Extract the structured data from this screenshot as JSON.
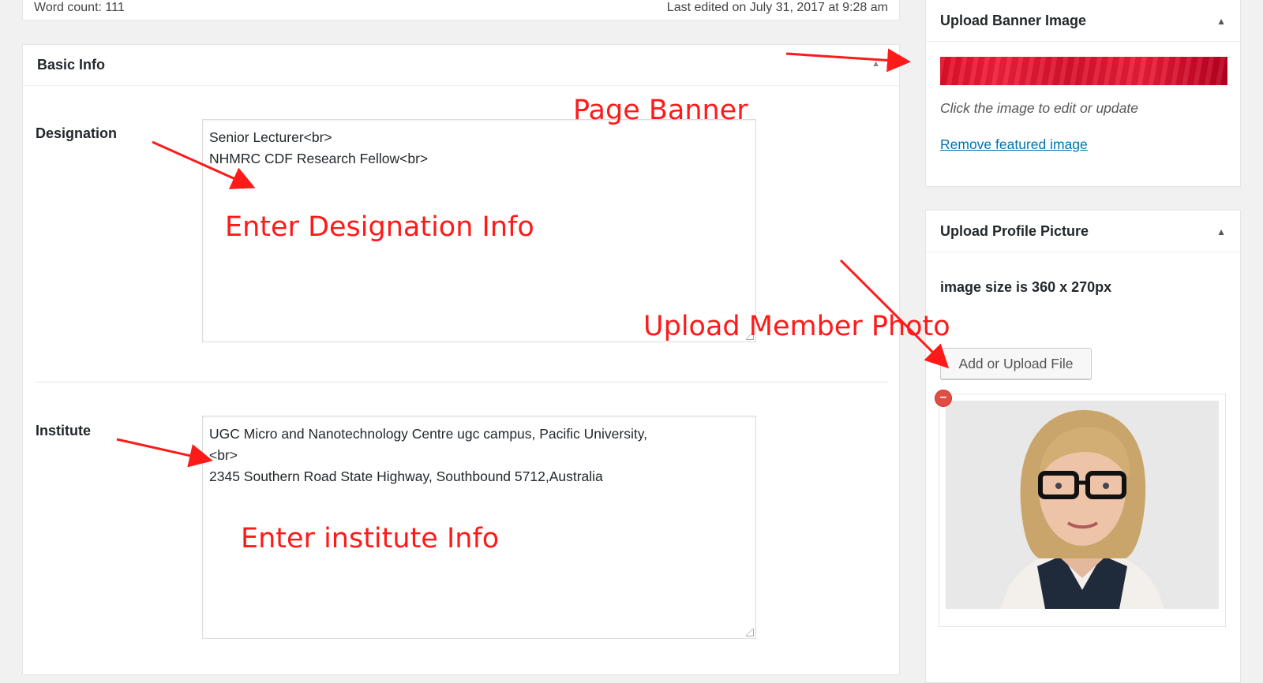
{
  "status_bar": {
    "word_count": "Word count: 111",
    "last_edited": "Last edited on July 31, 2017 at 9:28 am"
  },
  "basic_info": {
    "title": "Basic Info",
    "toggle_icon": "triangle-up-icon",
    "designation": {
      "label": "Designation",
      "lines": [
        "Senior Lecturer<br>",
        "NHMRC CDF Research Fellow<br>"
      ]
    },
    "institute": {
      "label": "Institute",
      "lines": [
        "UGC Micro and Nanotechnology Centre ugc campus, Pacific University,",
        "<br>",
        "2345 Southern Road State Highway, Southbound 5712,Australia"
      ]
    }
  },
  "banner_panel": {
    "title": "Upload Banner Image",
    "toggle_icon": "triangle-up-icon",
    "hint": "Click the image to edit or update",
    "remove_link": "Remove featured image",
    "banner_color": "#e0102a"
  },
  "profile_panel": {
    "title": "Upload Profile Picture",
    "toggle_icon": "triangle-up-icon",
    "image_size": "image size is 360 x 270px",
    "upload_button": "Add or Upload File",
    "remove_icon": "minus-circle-icon"
  },
  "annotations": {
    "page_banner": "Page Banner",
    "designation": "Enter Designation Info",
    "upload_photo": "Upload Member Photo",
    "institute": "Enter institute Info",
    "color": "#ff1a1a"
  }
}
